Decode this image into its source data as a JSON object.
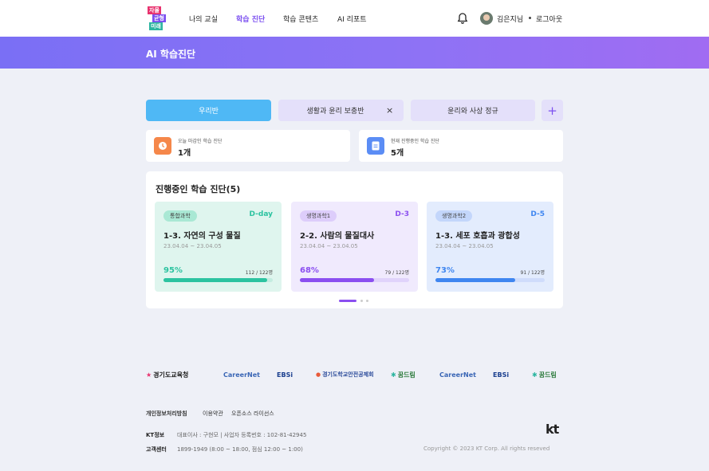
{
  "logo": {
    "line1": "자율",
    "line2": "균형",
    "line3": "미래"
  },
  "nav": {
    "items": [
      {
        "label": "나의 교실"
      },
      {
        "label": "학습 진단"
      },
      {
        "label": "학습 콘텐츠"
      },
      {
        "label": "AI 리포트"
      }
    ],
    "active_index": 1,
    "user_name": "김은지님",
    "logout_label": "로그아웃"
  },
  "banner": {
    "title": "AI 학습진단"
  },
  "tabs": [
    {
      "label": "우리반",
      "active": true
    },
    {
      "label": "생활과 윤리 보충반",
      "closable": true
    },
    {
      "label": "윤리와 사상 정규"
    }
  ],
  "tab_close_glyph": "×",
  "tab_add_glyph": "+",
  "stats": [
    {
      "label": "오늘 마감인 학습 진단",
      "value": "1개",
      "icon": "clock-icon",
      "color": "#f5874a"
    },
    {
      "label": "현재 진행중인 학습 진단",
      "value": "5개",
      "icon": "document-icon",
      "color": "#5b8df5"
    }
  ],
  "panel": {
    "title": "진행중인 학습 진단(5)",
    "cards": [
      {
        "tag": "통합과학",
        "dday": "D-day",
        "title": "1-3. 자연의 구성 물질",
        "date": "23.04.04 ~ 23.04.05",
        "percent_label": "95%",
        "progress": 0.95,
        "count": "112 / 122명",
        "bg": "#dff5ee",
        "accent": "#2cc3a0",
        "tag_bg": "#a9e8d4",
        "track": "#c4ece0"
      },
      {
        "tag": "생명과학1",
        "dday": "D-3",
        "title": "2-2. 사람의 물질대사",
        "date": "23.04.04 ~ 23.04.05",
        "percent_label": "68%",
        "progress": 0.68,
        "count": "79 / 122명",
        "bg": "#f0eafd",
        "accent": "#8b4ff0",
        "tag_bg": "#ddcdfb",
        "track": "#e0d3fb"
      },
      {
        "tag": "생명과학2",
        "dday": "D-5",
        "title": "1-3. 세포 호흡과 광합성",
        "date": "23.04.04 ~ 23.04.05",
        "percent_label": "73%",
        "progress": 0.73,
        "count": "91 / 122명",
        "bg": "#e3ecfd",
        "accent": "#3f86f0",
        "tag_bg": "#c3d6fb",
        "track": "#cfdcfb"
      }
    ]
  },
  "partners": [
    {
      "label": "경기도교육청",
      "color": "#222222"
    },
    {
      "label": "CareerNet",
      "color": "#3a66b5"
    },
    {
      "label": "EBSi",
      "color": "#1a3f8f"
    },
    {
      "label": "경기도학교안전공제회",
      "color": "#2a4a9a"
    },
    {
      "label": "꿈드림",
      "color": "#2a7a3a"
    },
    {
      "label": "CareerNet",
      "color": "#3a66b5"
    },
    {
      "label": "EBSi",
      "color": "#1a3f8f"
    },
    {
      "label": "꿈드림",
      "color": "#2a7a3a"
    }
  ],
  "footer": {
    "links": [
      "개인정보처리방침",
      "이용약관",
      "오픈소스 라이선스"
    ],
    "kt_label": "KT정보",
    "kt_info": "대표이사 : 구현모 | 사업자 등록번호 : 102-81-42945",
    "cs_label": "고객센터",
    "cs_info": "1899-1949 (8:00 ~ 18:00, 점심 12:00 ~ 1:00)",
    "brand": "kt",
    "copyright": "Copyright © 2023 KT Corp. All rights reseved"
  }
}
